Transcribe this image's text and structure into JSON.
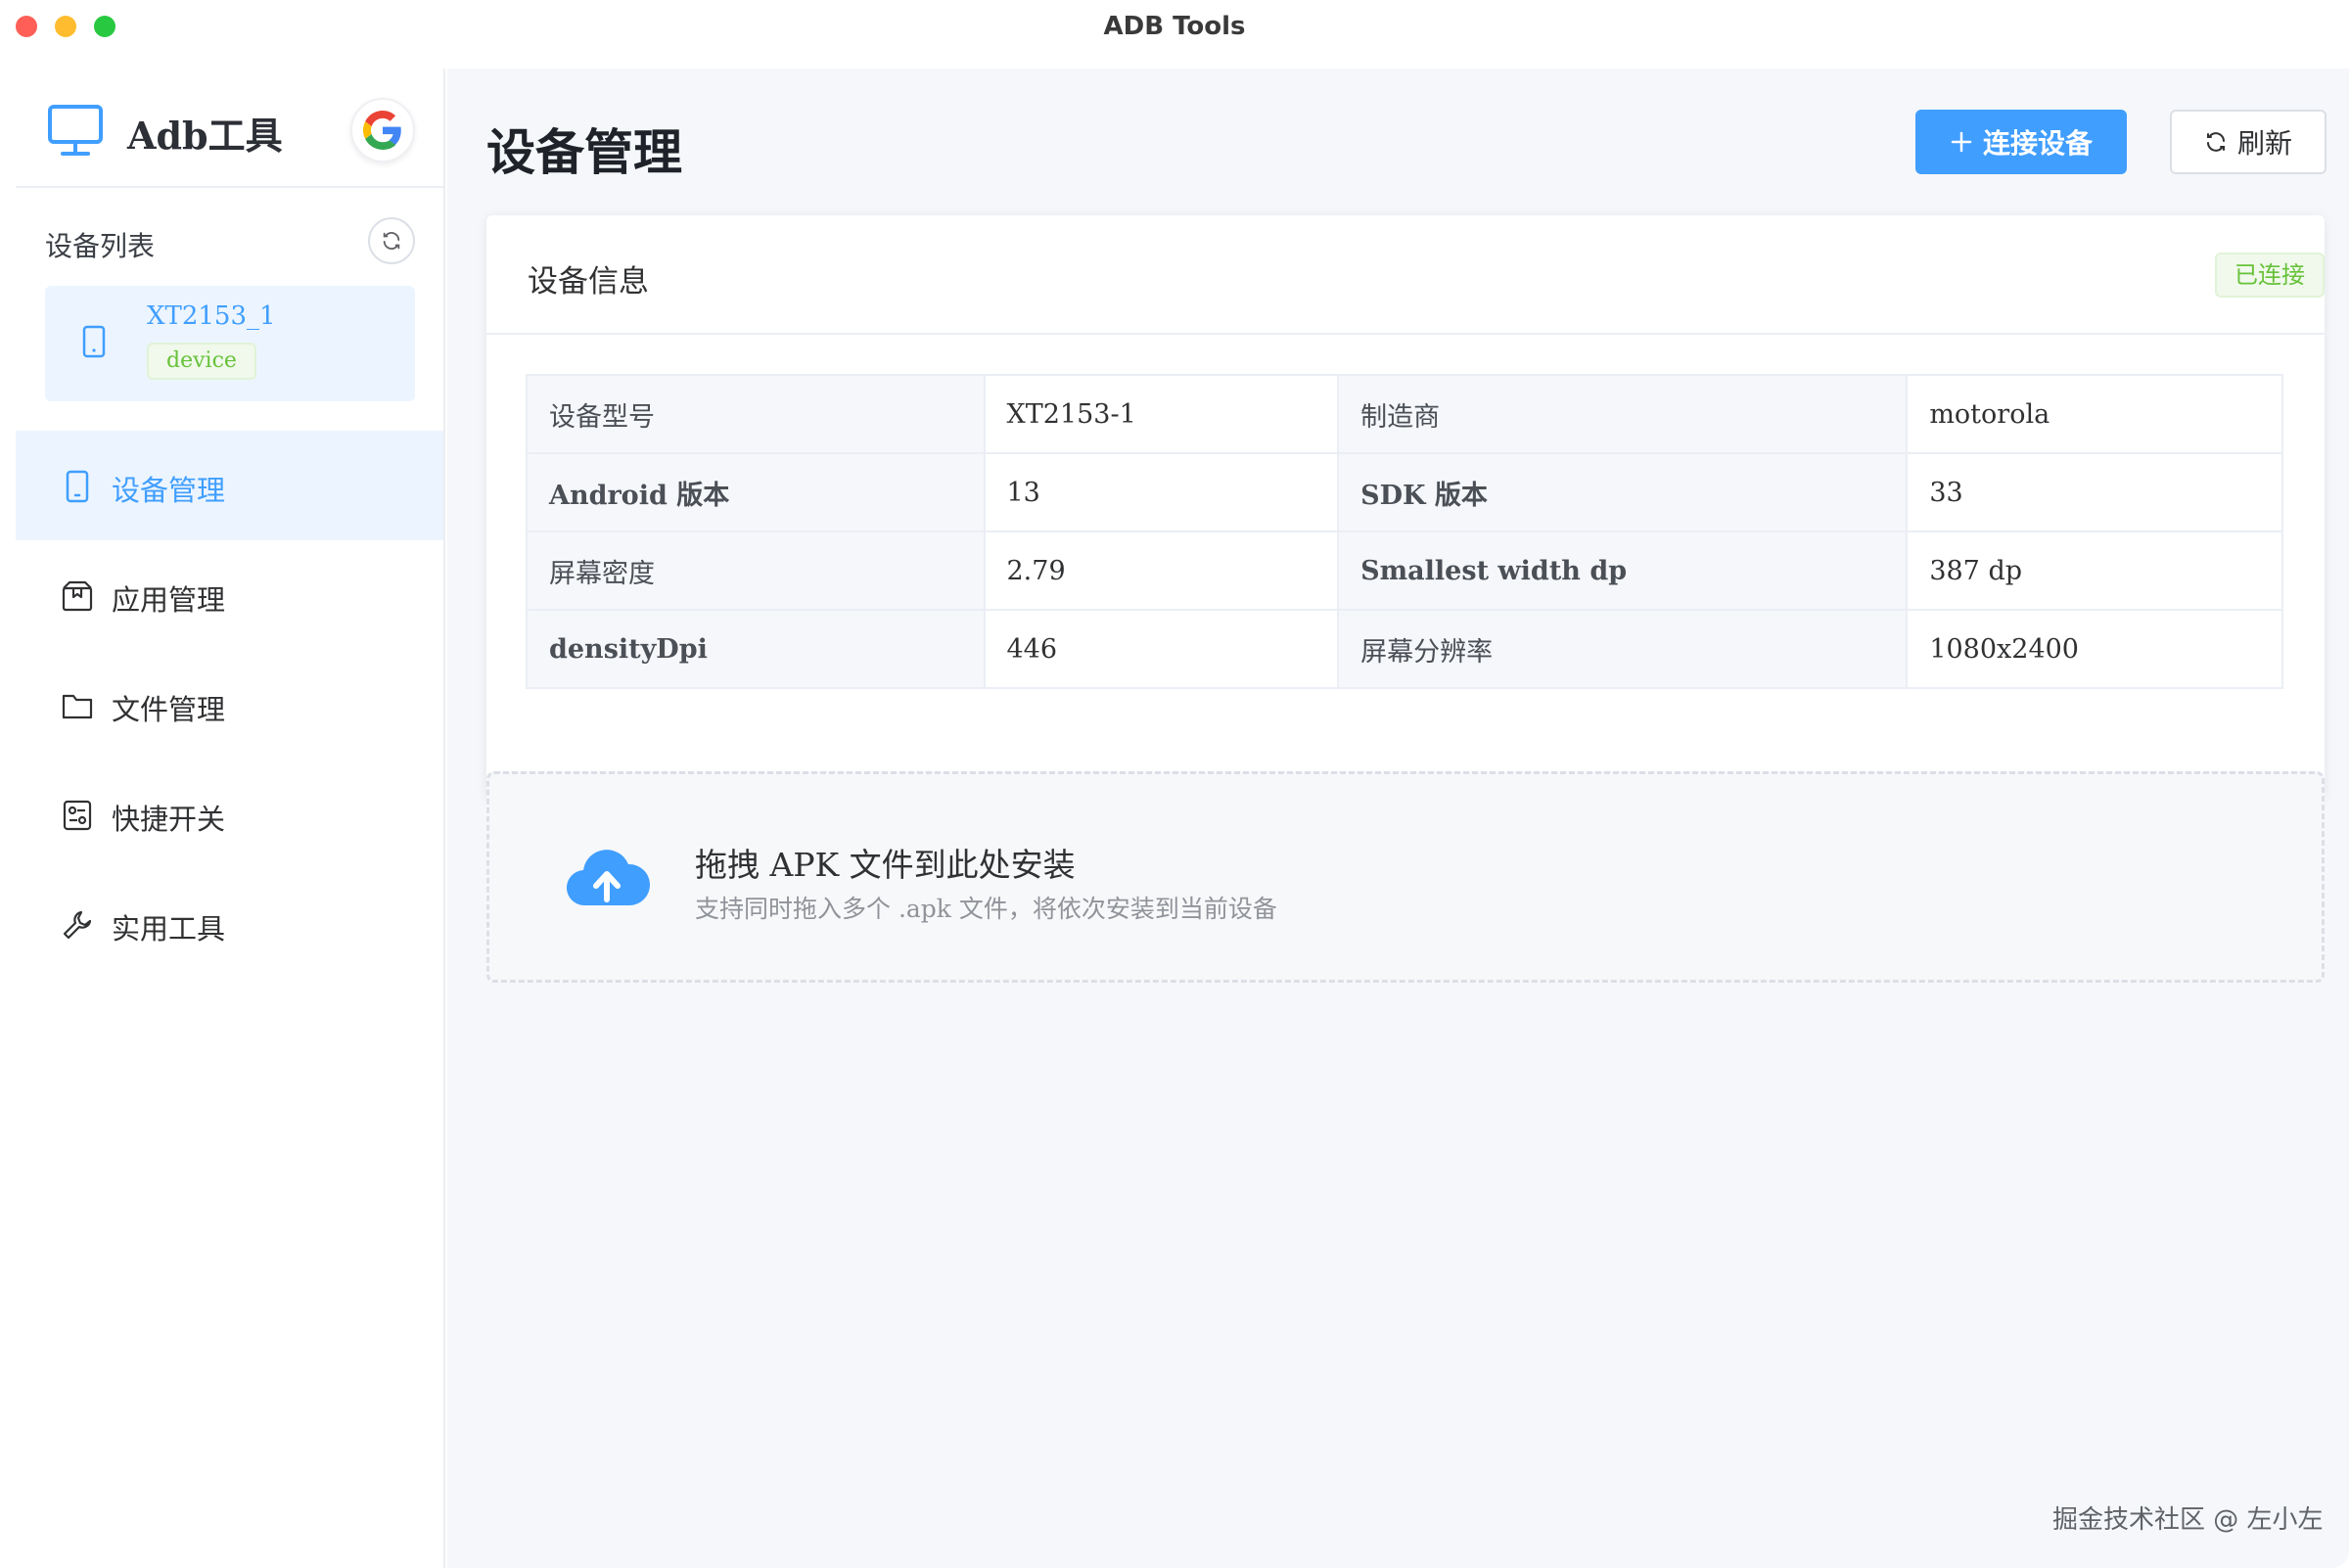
{
  "window": {
    "title": "ADB Tools"
  },
  "sidebar": {
    "brand": "Adb工具",
    "device_list_title": "设备列表",
    "device": {
      "name": "XT2153_1",
      "tag": "device"
    },
    "nav": [
      {
        "label": "设备管理",
        "icon": "tablet-icon",
        "active": true
      },
      {
        "label": "应用管理",
        "icon": "package-icon",
        "active": false
      },
      {
        "label": "文件管理",
        "icon": "folder-icon",
        "active": false
      },
      {
        "label": "快捷开关",
        "icon": "switches-icon",
        "active": false
      },
      {
        "label": "实用工具",
        "icon": "wrench-icon",
        "active": false
      }
    ]
  },
  "main": {
    "title": "设备管理",
    "connect_button": "连接设备",
    "refresh_button": "刷新",
    "card": {
      "title": "设备信息",
      "status": "已连接",
      "rows": [
        [
          "设备型号",
          "XT2153-1",
          "制造商",
          "motorola"
        ],
        [
          "Android 版本",
          "13",
          "SDK 版本",
          "33"
        ],
        [
          "屏幕密度",
          "2.79",
          "Smallest width dp",
          "387 dp"
        ],
        [
          "densityDpi",
          "446",
          "屏幕分辨率",
          "1080x2400"
        ]
      ]
    },
    "dropzone": {
      "title": "拖拽 APK 文件到此处安装",
      "subtitle": "支持同时拖入多个 .apk 文件，将依次安装到当前设备"
    }
  },
  "watermark": "掘金技术社区 @ 左小左",
  "colors": {
    "primary": "#409eff",
    "success": "#67c23a",
    "background": "#f5f7fa"
  }
}
